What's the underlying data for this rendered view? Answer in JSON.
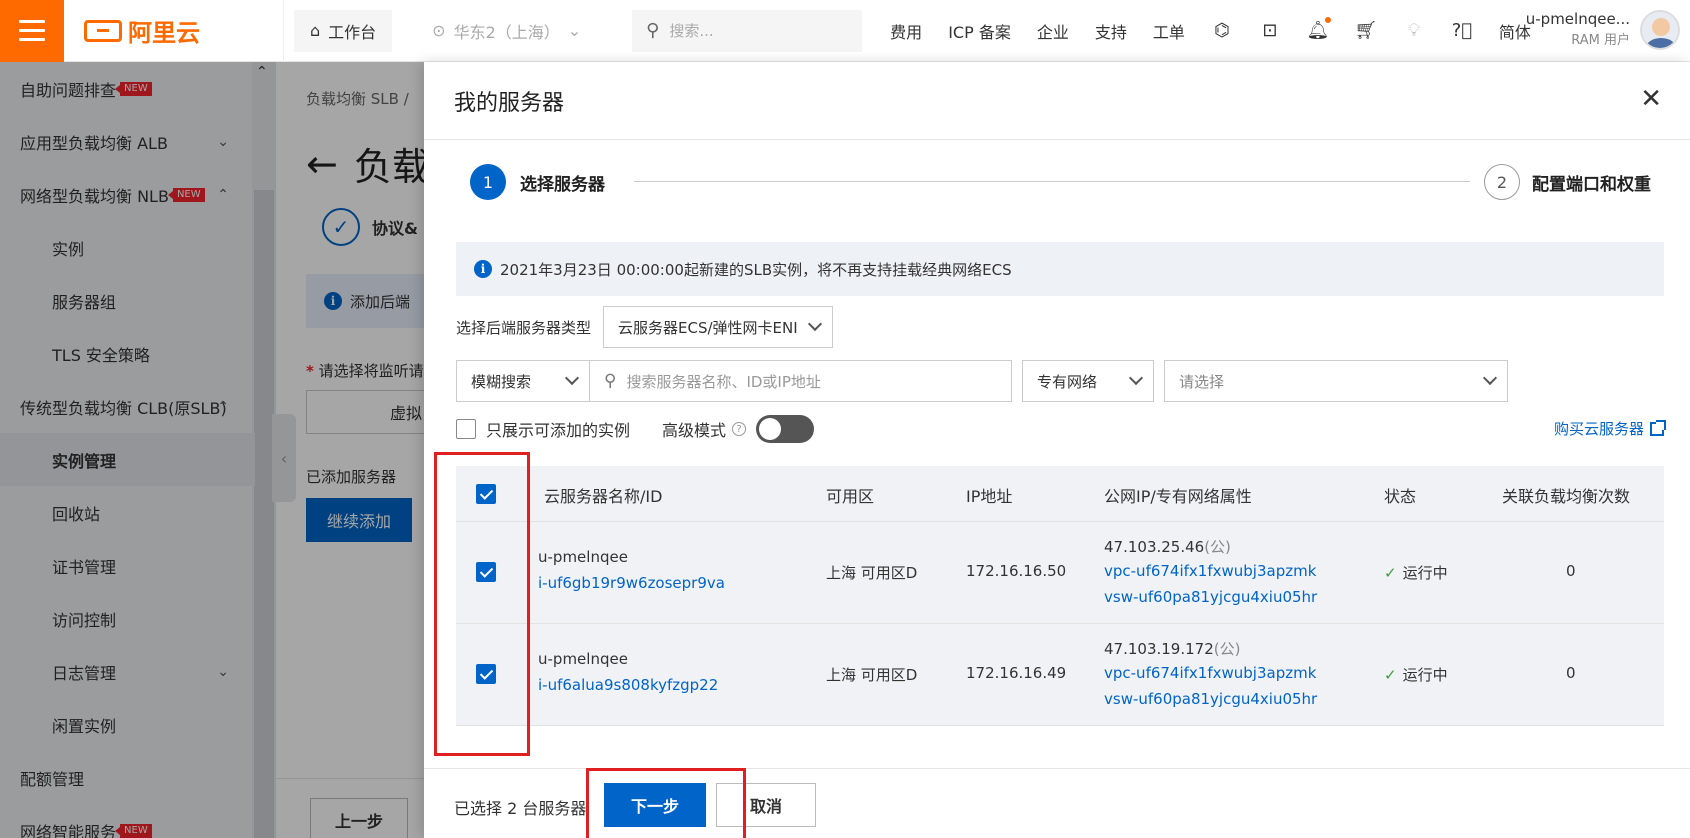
{
  "topbar": {
    "logo": "阿里云",
    "workbench": "工作台",
    "region": "华东2（上海）",
    "search_placeholder": "搜索...",
    "nav": [
      "费用",
      "ICP 备案",
      "企业",
      "支持",
      "工单"
    ],
    "lang": "简体",
    "user_name": "u-pmelnqee...",
    "user_role": "RAM 用户",
    "accent_color": "#ff6a00"
  },
  "sidebar": {
    "items": [
      {
        "label": "自助问题排查",
        "badge": "NEW"
      },
      {
        "label": "应用型负载均衡 ALB"
      },
      {
        "label": "网络型负载均衡 NLB",
        "badge": "NEW"
      },
      {
        "label": "实例"
      },
      {
        "label": "服务器组"
      },
      {
        "label": "TLS 安全策略"
      },
      {
        "label": "传统型负载均衡 CLB(原SLB)"
      },
      {
        "label": "实例管理"
      },
      {
        "label": "回收站"
      },
      {
        "label": "证书管理"
      },
      {
        "label": "访问控制"
      },
      {
        "label": "日志管理"
      },
      {
        "label": "闲置实例"
      },
      {
        "label": "配额管理"
      },
      {
        "label": "网络智能服务",
        "badge": "NEW"
      }
    ]
  },
  "background": {
    "breadcrumb": "负载均衡 SLB /",
    "title": "负载",
    "step_label": "协议&",
    "notice": "添加后端",
    "required_label": "请选择将监听请",
    "input_text": "虚拟",
    "added_servers": "已添加服务器",
    "add_more": "继续添加",
    "prev": "上一步"
  },
  "drawer": {
    "title": "我的服务器",
    "steps": [
      {
        "num": "1",
        "label": "选择服务器"
      },
      {
        "num": "2",
        "label": "配置端口和权重"
      }
    ],
    "notice": "2021年3月23日 00:00:00起新建的SLB实例，将不再支持挂载经典网络ECS",
    "type_label": "选择后端服务器类型",
    "type_value": "云服务器ECS/弹性网卡ENI",
    "search_mode": "模糊搜索",
    "search_placeholder": "搜索服务器名称、ID或IP地址",
    "network_type": "专有网络",
    "choose_placeholder": "请选择",
    "only_addable": "只展示可添加的实例",
    "advanced_mode": "高级模式",
    "buy_link": "购买云服务器",
    "table": {
      "headers": [
        "云服务器名称/ID",
        "可用区",
        "IP地址",
        "公网IP/专有网络属性",
        "状态",
        "关联负载均衡次数"
      ],
      "rows": [
        {
          "name": "u-pmelnqee",
          "id": "i-uf6gb19r9w6zosepr9va",
          "zone": "上海 可用区D",
          "ip": "172.16.16.50",
          "public_ip": "47.103.25.46",
          "public_tag": "(公)",
          "vpc": "vpc-uf674ifx1fxwubj3apzmk",
          "vsw": "vsw-uf60pa81yjcgu4xiu05hr",
          "status": "运行中",
          "count": "0"
        },
        {
          "name": "u-pmelnqee",
          "id": "i-uf6alua9s808kyfzgp22",
          "zone": "上海 可用区D",
          "ip": "172.16.16.49",
          "public_ip": "47.103.19.172",
          "public_tag": "(公)",
          "vpc": "vpc-uf674ifx1fxwubj3apzmk",
          "vsw": "vsw-uf60pa81yjcgu4xiu05hr",
          "status": "运行中",
          "count": "0"
        }
      ]
    },
    "selected_count": "已选择 2 台服务器",
    "next": "下一步",
    "cancel": "取消",
    "primary_color": "#0064c8",
    "highlight_color": "#e02020"
  }
}
